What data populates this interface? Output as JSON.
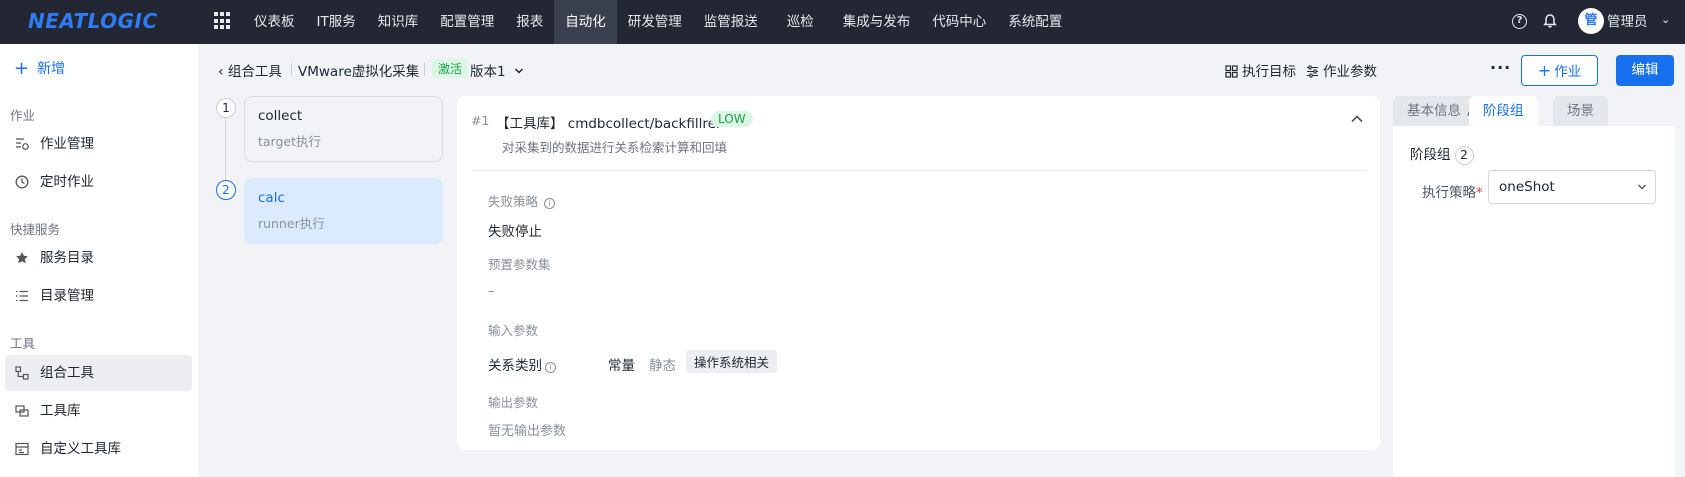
{
  "app": {
    "logo": "NEATLOGIC",
    "nav": [
      "仪表板",
      "IT服务",
      "知识库",
      "配置管理",
      "报表",
      "自动化",
      "研发管理",
      "监管报送",
      "巡检",
      "集成与发布",
      "代码中心",
      "系统配置"
    ],
    "nav_active_index": 5,
    "user": {
      "avatar_text": "管",
      "name": "管理员"
    }
  },
  "sidebar": {
    "add_label": "新增",
    "groups": [
      {
        "title": "作业",
        "items": [
          {
            "label": "作业管理",
            "icon": "job-list-icon"
          },
          {
            "label": "定时作业",
            "icon": "clock-icon"
          }
        ]
      },
      {
        "title": "快捷服务",
        "items": [
          {
            "label": "服务目录",
            "icon": "star-icon"
          },
          {
            "label": "目录管理",
            "icon": "list-icon"
          }
        ]
      },
      {
        "title": "工具",
        "items": [
          {
            "label": "组合工具",
            "icon": "combo-tool-icon",
            "active": true
          },
          {
            "label": "工具库",
            "icon": "tool-library-icon"
          },
          {
            "label": "自定义工具库",
            "icon": "custom-tool-icon"
          }
        ]
      }
    ]
  },
  "header": {
    "back_label": "组合工具",
    "tool_name": "VMware虚拟化采集",
    "status": "激活",
    "version": "版本1",
    "exec_target": "执行目标",
    "job_params": "作业参数",
    "more": "···",
    "job_button": "作业",
    "edit_button": "编辑"
  },
  "steps": [
    {
      "number": "1",
      "title": "collect",
      "subtitle": "target执行",
      "active": false
    },
    {
      "number": "2",
      "title": "calc",
      "subtitle": "runner执行",
      "active": true
    }
  ],
  "card": {
    "index": "#1",
    "title": "【工具库】 cmdbcollect/backfillrel",
    "risk": "LOW",
    "description": "对采集到的数据进行关系检索计算和回填",
    "fail_policy_label": "失败策略",
    "fail_policy_value": "失败停止",
    "preset_label": "预置参数集",
    "preset_value": "–",
    "input_label": "输入参数",
    "input_param_name": "关系类别",
    "input_mode_const": "常量",
    "input_mode_static": "静态",
    "input_value": "操作系统相关",
    "output_label": "输出参数",
    "output_value": "暂无输出参数"
  },
  "right_panel": {
    "tabs": [
      "基本信息",
      "阶段组",
      "场景"
    ],
    "active_tab": 1,
    "group_title": "阶段组",
    "group_count": "2",
    "policy_label": "执行策略",
    "policy_required": "*",
    "policy_value": "oneShot"
  },
  "colors": {
    "primary": "#1670f0",
    "topbar": "#232733",
    "success_bg": "#dcf5e4",
    "success_text": "#1aa34a"
  }
}
